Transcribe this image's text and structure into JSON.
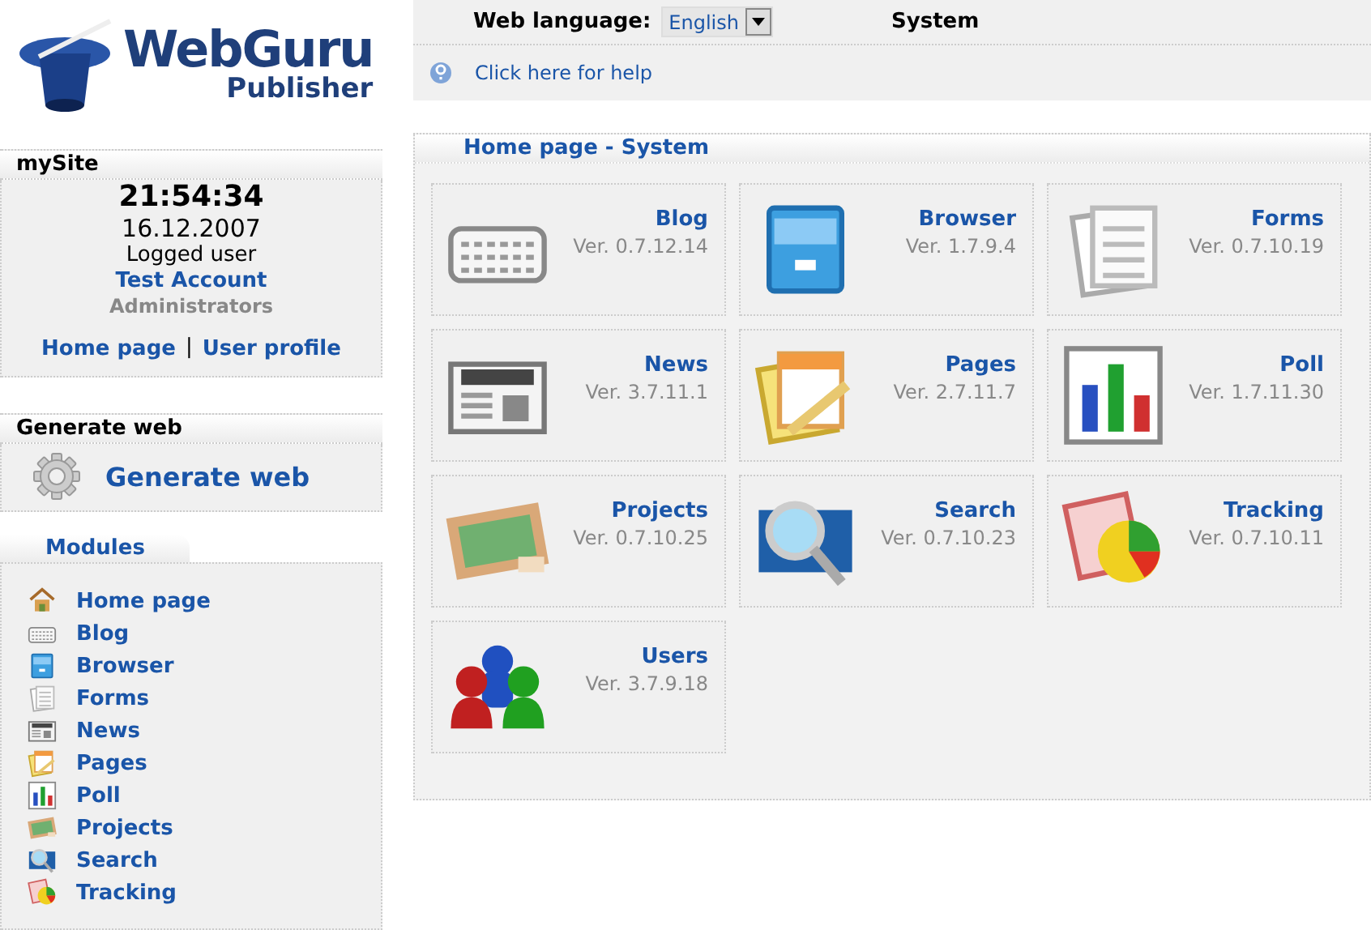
{
  "logo": {
    "title": "WebGuru",
    "subtitle": "Publisher"
  },
  "top_bar": {
    "language_label": "Web language:",
    "language": "English",
    "section": "System"
  },
  "help_link": "Click here for help",
  "my_site": {
    "title": "mySite",
    "time": "21:54:34",
    "date": "16.12.2007",
    "user_label": "Logged user",
    "user": "Test Account",
    "group": "Administrators",
    "links": [
      "Home page",
      "User profile"
    ],
    "separator": "|"
  },
  "generate": {
    "title": "Generate web",
    "button": "Generate web"
  },
  "modules": {
    "title": "Modules",
    "items": [
      {
        "label": "Home page",
        "kind": "home"
      },
      {
        "label": "Blog",
        "kind": "blog"
      },
      {
        "label": "Browser",
        "kind": "browser"
      },
      {
        "label": "Forms",
        "kind": "forms"
      },
      {
        "label": "News",
        "kind": "news"
      },
      {
        "label": "Pages",
        "kind": "pages"
      },
      {
        "label": "Poll",
        "kind": "poll"
      },
      {
        "label": "Projects",
        "kind": "projects"
      },
      {
        "label": "Search",
        "kind": "search"
      },
      {
        "label": "Tracking",
        "kind": "tracking"
      }
    ]
  },
  "content": {
    "breadcrumb": "Home page  - System",
    "cards": [
      {
        "name": "Blog",
        "version": "Ver. 0.7.12.14",
        "kind": "blog"
      },
      {
        "name": "Browser",
        "version": "Ver. 1.7.9.4",
        "kind": "browser"
      },
      {
        "name": "Forms",
        "version": "Ver. 0.7.10.19",
        "kind": "forms"
      },
      {
        "name": "News",
        "version": "Ver. 3.7.11.1",
        "kind": "news"
      },
      {
        "name": "Pages",
        "version": "Ver. 2.7.11.7",
        "kind": "pages"
      },
      {
        "name": "Poll",
        "version": "Ver. 1.7.11.30",
        "kind": "poll"
      },
      {
        "name": "Projects",
        "version": "Ver. 0.7.10.25",
        "kind": "projects"
      },
      {
        "name": "Search",
        "version": "Ver. 0.7.10.23",
        "kind": "search"
      },
      {
        "name": "Tracking",
        "version": "Ver. 0.7.10.11",
        "kind": "tracking"
      },
      {
        "name": "Users",
        "version": "Ver. 3.7.9.18",
        "kind": "users"
      }
    ]
  }
}
